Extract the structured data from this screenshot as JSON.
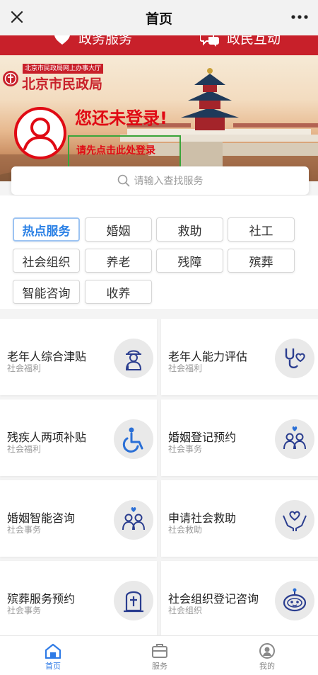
{
  "topbar": {
    "title": "首页"
  },
  "redstrip": {
    "tab1": "政务服务",
    "tab2": "政民互动"
  },
  "banner": {
    "org_sub": "北京市民政局网上办事大厅",
    "org_name": "北京市民政局",
    "not_logged": "您还未登录!",
    "login_prompt": "请先点击此处登录"
  },
  "search": {
    "placeholder": "请输入查找服务"
  },
  "tags": [
    {
      "label": "热点服务",
      "active": true
    },
    {
      "label": "婚姻"
    },
    {
      "label": "救助"
    },
    {
      "label": "社工"
    },
    {
      "label": "社会组织"
    },
    {
      "label": "养老"
    },
    {
      "label": "残障"
    },
    {
      "label": "殡葬"
    },
    {
      "label": "智能咨询"
    },
    {
      "label": "收养"
    }
  ],
  "services": [
    {
      "title": "老年人综合津贴",
      "category": "社会福利",
      "icon": "elderly-icon"
    },
    {
      "title": "老年人能力评估",
      "category": "社会福利",
      "icon": "stethoscope-heart-icon"
    },
    {
      "title": "残疾人两项补贴",
      "category": "社会福利",
      "icon": "wheelchair-icon"
    },
    {
      "title": "婚姻登记预约",
      "category": "社会事务",
      "icon": "couple-icon"
    },
    {
      "title": "婚姻智能咨询",
      "category": "社会事务",
      "icon": "couple-icon"
    },
    {
      "title": "申请社会救助",
      "category": "社会救助",
      "icon": "hands-heart-icon"
    },
    {
      "title": "殡葬服务预约",
      "category": "社会事务",
      "icon": "tombstone-icon"
    },
    {
      "title": "社会组织登记咨询",
      "category": "社会组织",
      "icon": "robot-icon"
    }
  ],
  "nav": [
    {
      "label": "首页",
      "icon": "home-icon",
      "active": true
    },
    {
      "label": "服务",
      "icon": "briefcase-icon"
    },
    {
      "label": "我的",
      "icon": "user-icon"
    }
  ],
  "colors": {
    "brand_red": "#c8202a",
    "accent_blue": "#2a80e5",
    "icon_navy": "#2a3d8f",
    "login_box_green": "#3aa53a"
  }
}
